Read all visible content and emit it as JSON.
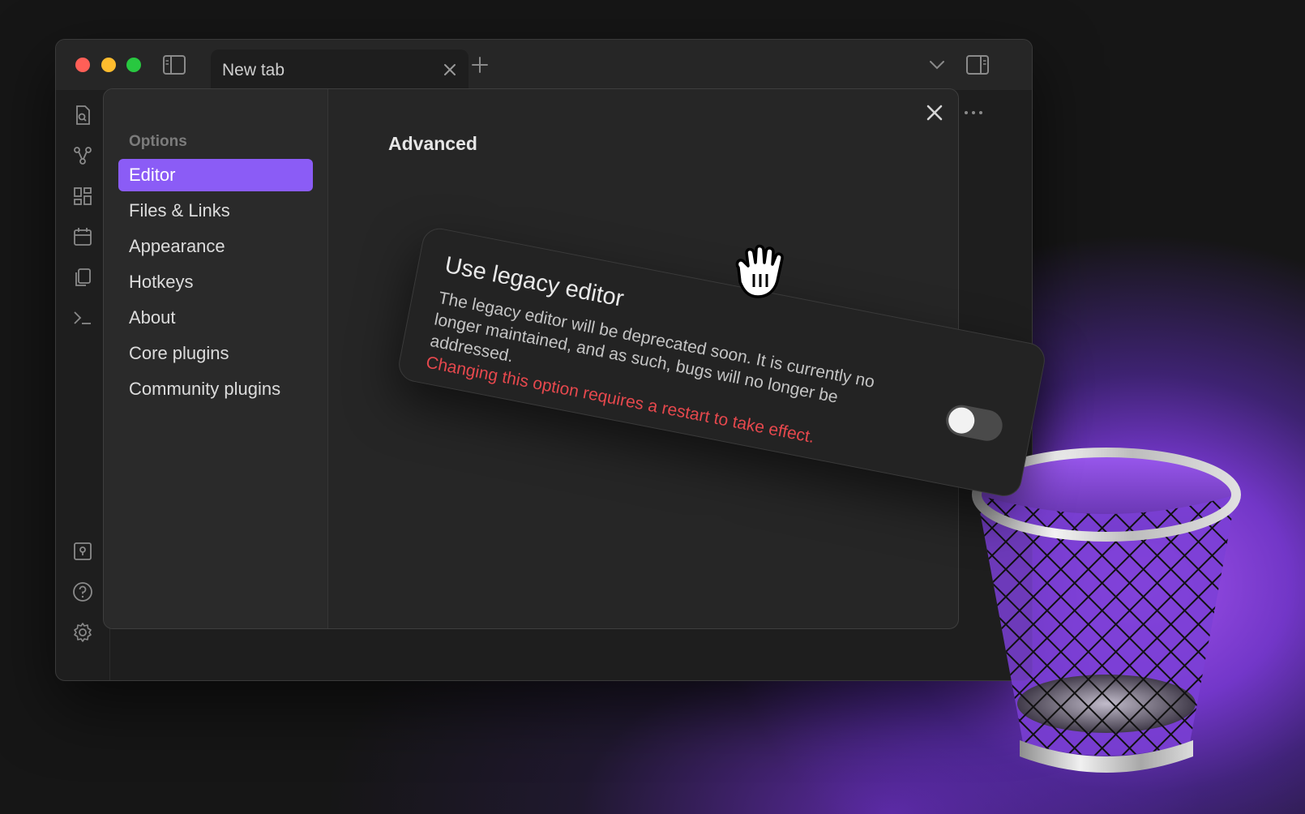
{
  "tab": {
    "title": "New tab"
  },
  "modal": {
    "sidebar_heading": "Options",
    "nav": [
      "Editor",
      "Files & Links",
      "Appearance",
      "Hotkeys",
      "About",
      "Core plugins",
      "Community plugins"
    ],
    "active_item": "Editor",
    "section_title": "Advanced"
  },
  "setting": {
    "title": "Use legacy editor",
    "description": "The legacy editor will be deprecated soon. It is currently no longer maintained, and as such, bugs will no longer be addressed.",
    "warning": "Changing this option requires a restart to take effect.",
    "toggle_on": false
  },
  "colors": {
    "accent": "#8b5cf6",
    "warning": "#e5484d",
    "background_glow": "#a855f7"
  },
  "icons": {
    "titlebar": [
      "sidebar-toggle-icon",
      "close-icon",
      "plus-icon",
      "chevron-down-icon",
      "right-sidebar-icon"
    ],
    "ribbon": [
      "search-file-icon",
      "graph-icon",
      "dashboard-icon",
      "calendar-icon",
      "copy-icon",
      "terminal-icon",
      "vault-icon",
      "help-icon",
      "settings-icon"
    ],
    "decor": [
      "grab-hand-cursor-icon",
      "trash-bin-icon"
    ]
  }
}
